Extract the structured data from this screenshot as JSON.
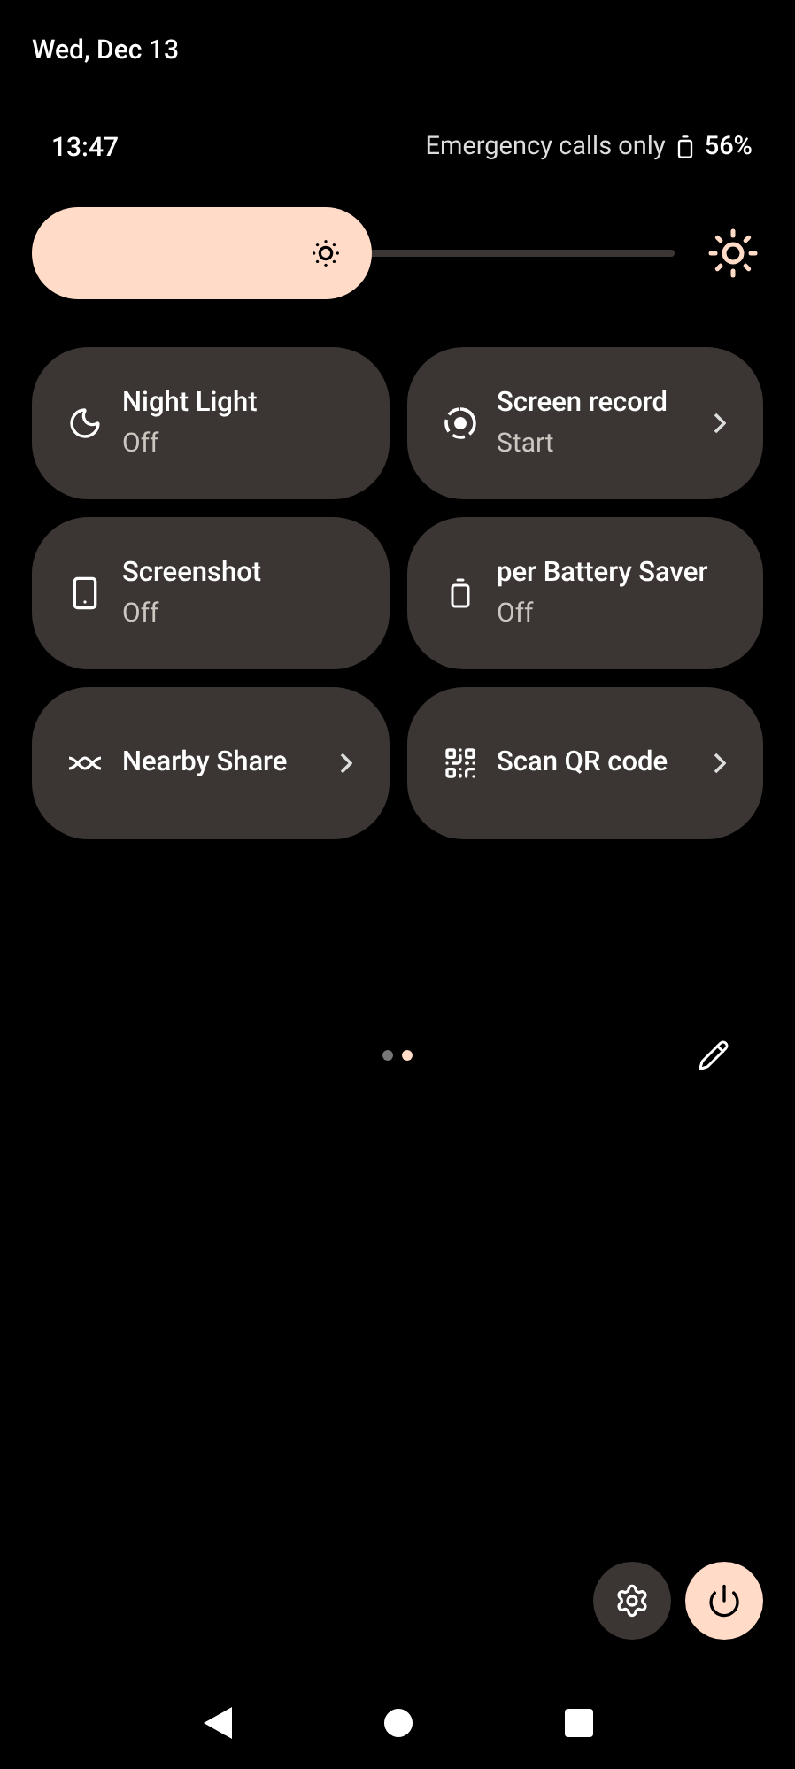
{
  "header": {
    "date": "Wed, Dec 13"
  },
  "status_bar": {
    "time": "13:47",
    "network": "Emergency calls only",
    "battery": "56%"
  },
  "brightness": {
    "level": 0.53
  },
  "tiles": [
    {
      "kind": "toggle",
      "title": "Night Light",
      "subtitle": "Off"
    },
    {
      "kind": "link",
      "title": "Screen record",
      "subtitle": "Start"
    },
    {
      "kind": "toggle",
      "title": "Screenshot",
      "subtitle": "Off"
    },
    {
      "kind": "toggle",
      "title": "per Battery Saver",
      "subtitle": "Off"
    },
    {
      "kind": "link",
      "title": "Nearby Share"
    },
    {
      "kind": "link",
      "title": "Scan QR code"
    }
  ],
  "pages": [
    {
      "selected": false
    },
    {
      "selected": true
    }
  ]
}
